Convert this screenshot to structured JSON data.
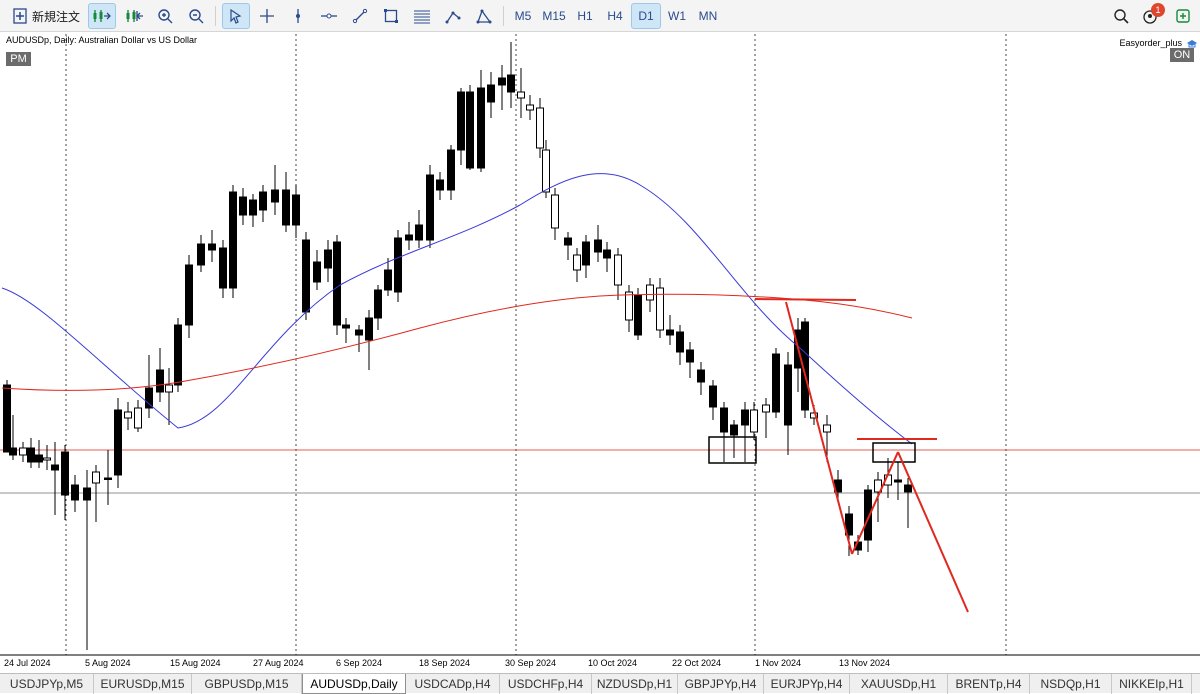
{
  "toolbar": {
    "new_order_label": "新規注文",
    "timeframes": [
      "M5",
      "M15",
      "H1",
      "H4",
      "D1",
      "W1",
      "MN"
    ],
    "active_timeframe": "D1",
    "notification_count": "1"
  },
  "chart": {
    "title": "AUDUSDp, Daily:  Australian Dollar vs US Dollar",
    "session_badge": "PM",
    "ea_name": "Easyorder_plus",
    "autotrading_badge": "ON",
    "dates": [
      "24 Jul 2024",
      "5 Aug 2024",
      "15 Aug 2024",
      "27 Aug 2024",
      "6 Sep 2024",
      "18 Sep 2024",
      "30 Sep 2024",
      "10 Oct 2024",
      "22 Oct 2024",
      "1 Nov 2024",
      "13 Nov 2024"
    ]
  },
  "chart_data": {
    "type": "candlestick",
    "symbol": "AUDUSDp",
    "timeframe": "Daily",
    "series": [
      {
        "name": "short moving average",
        "color": "#3a3ad6"
      },
      {
        "name": "long moving average",
        "color": "#e0281e"
      }
    ],
    "annotations": [
      "support box",
      "resistance box",
      "downtrend line",
      "projection line"
    ],
    "colors": {
      "bull": "#ffffff",
      "bear": "#000000",
      "grid": "#000000"
    }
  },
  "symbol_tabs": [
    "USDJPYp,M5",
    "EURUSDp,M15",
    "GBPUSDp,M15",
    "AUDUSDp,Daily",
    "USDCADp,H4",
    "USDCHFp,H4",
    "NZDUSDp,H1",
    "GBPJPYp,H4",
    "EURJPYp,H4",
    "XAUUSDp,H1",
    "BRENTp,H4",
    "NSDQp,H1",
    "NIKKEIp,H1"
  ],
  "active_tab": "AUDUSDp,Daily"
}
